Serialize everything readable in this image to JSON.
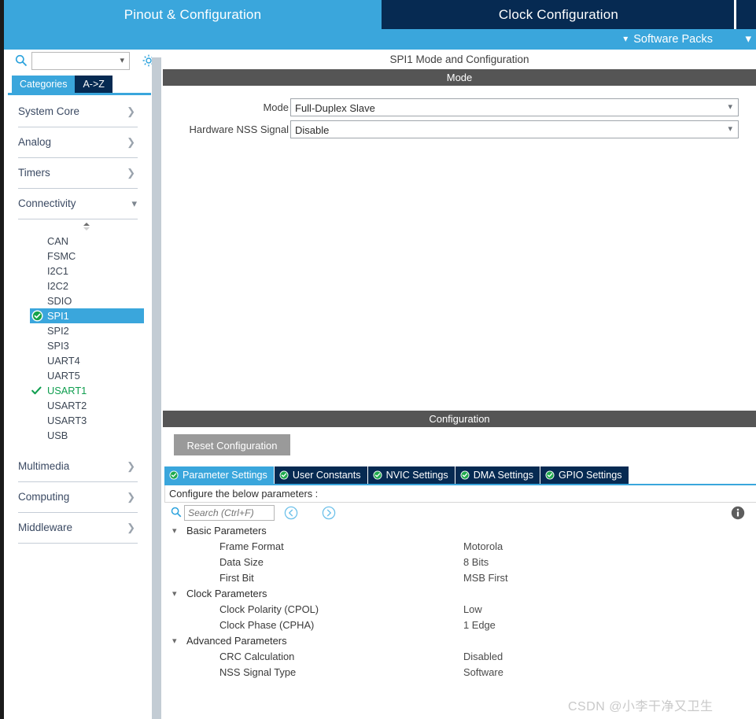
{
  "topbar": {
    "tabs": [
      {
        "label": "Pinout & Configuration",
        "active": true
      },
      {
        "label": "Clock Configuration",
        "active": false
      }
    ],
    "software_packs": {
      "label": "Software Packs",
      "chevron": "chevron-down-icon"
    },
    "colors": {
      "accent_blue": "#3aa6dc",
      "navy": "#062a52"
    }
  },
  "sidebar": {
    "search": {
      "value": "",
      "placeholder": ""
    },
    "gear_icon": "gear-icon",
    "view_tabs": [
      {
        "label": "Categories",
        "active": true
      },
      {
        "label": "A->Z",
        "active": false
      }
    ],
    "categories": [
      {
        "label": "System Core",
        "expanded": false
      },
      {
        "label": "Analog",
        "expanded": false
      },
      {
        "label": "Timers",
        "expanded": false
      },
      {
        "label": "Connectivity",
        "expanded": true
      },
      {
        "label": "Multimedia",
        "expanded": false
      },
      {
        "label": "Computing",
        "expanded": false
      },
      {
        "label": "Middleware",
        "expanded": false
      }
    ],
    "connectivity_peripherals": [
      {
        "label": "CAN",
        "state": "none"
      },
      {
        "label": "FSMC",
        "state": "none"
      },
      {
        "label": "I2C1",
        "state": "none"
      },
      {
        "label": "I2C2",
        "state": "none"
      },
      {
        "label": "SDIO",
        "state": "none"
      },
      {
        "label": "SPI1",
        "state": "selected"
      },
      {
        "label": "SPI2",
        "state": "none"
      },
      {
        "label": "SPI3",
        "state": "none"
      },
      {
        "label": "UART4",
        "state": "none"
      },
      {
        "label": "UART5",
        "state": "none"
      },
      {
        "label": "USART1",
        "state": "enabled"
      },
      {
        "label": "USART2",
        "state": "none"
      },
      {
        "label": "USART3",
        "state": "none"
      },
      {
        "label": "USB",
        "state": "none"
      }
    ]
  },
  "main": {
    "title": "SPI1 Mode and Configuration",
    "mode_section": {
      "header": "Mode",
      "fields": [
        {
          "label": "Mode",
          "value": "Full-Duplex Slave"
        },
        {
          "label": "Hardware NSS Signal",
          "value": "Disable"
        }
      ]
    },
    "configuration_section": {
      "header": "Configuration",
      "reset_button": "Reset Configuration",
      "tabs": [
        {
          "label": "Parameter Settings",
          "active": true
        },
        {
          "label": "User Constants",
          "active": false
        },
        {
          "label": "NVIC Settings",
          "active": false
        },
        {
          "label": "DMA Settings",
          "active": false
        },
        {
          "label": "GPIO Settings",
          "active": false
        }
      ],
      "note": "Configure the below parameters :",
      "search": {
        "value": "",
        "placeholder": "Search (Ctrl+F)"
      },
      "nav_prev_icon": "chevron-left-circle-icon",
      "nav_next_icon": "chevron-right-circle-icon",
      "info_icon": "info-icon",
      "parameter_groups": [
        {
          "name": "Basic Parameters",
          "expanded": true,
          "items": [
            {
              "label": "Frame Format",
              "value": "Motorola"
            },
            {
              "label": "Data Size",
              "value": "8 Bits"
            },
            {
              "label": "First Bit",
              "value": "MSB First"
            }
          ]
        },
        {
          "name": "Clock Parameters",
          "expanded": true,
          "items": [
            {
              "label": "Clock Polarity (CPOL)",
              "value": "Low"
            },
            {
              "label": "Clock Phase (CPHA)",
              "value": "1 Edge"
            }
          ]
        },
        {
          "name": "Advanced Parameters",
          "expanded": true,
          "items": [
            {
              "label": "CRC Calculation",
              "value": "Disabled"
            },
            {
              "label": "NSS Signal Type",
              "value": "Software"
            }
          ]
        }
      ]
    }
  },
  "watermark": {
    "text": "CSDN @小李干净又卫生"
  }
}
